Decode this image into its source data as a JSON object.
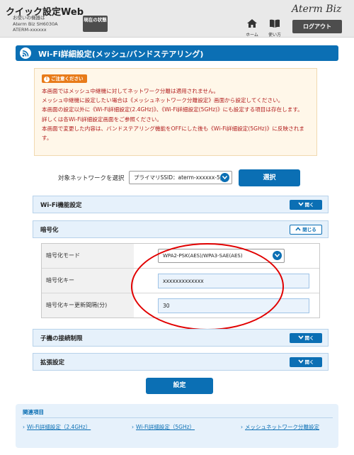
{
  "header": {
    "app_title": "クイック設定Web",
    "model_label": "お使いの機器は",
    "model_name": "Aterm Biz SH6030A",
    "ssid": "ATERM-xxxxxx",
    "status_button": "現在の状態",
    "brand": "Aterm Biz",
    "home_label": "ホーム",
    "guide_label": "使い方",
    "logout_button": "ログアウト"
  },
  "page": {
    "title": "Wi-Fi詳細設定(メッシュ/バンドステアリング)"
  },
  "notice": {
    "badge": "ご注意ください",
    "lines": [
      "本画面ではメッシュ中継機に対してネットワーク分離は適用されません。",
      "メッシュ中継機に設定したい場合は《メッシュネットワーク分離設定》画面から設定してください。",
      "本画面の設定以外に《Wi-Fi詳細設定(2.4GHz)》、《Wi-Fi詳細設定(5GHz)》にも設定する項目は存在します。",
      "詳しくは各Wi-Fi詳細設定画面をご参照ください。",
      "本画面で変更した内容は、バンドステアリング機能をOFFにした後も《Wi-Fi詳細設定(5GHz)》に反映されます。"
    ]
  },
  "network_select": {
    "label": "対象ネットワークを選択",
    "value": "プライマリSSID：aterm-xxxxxx-5p",
    "button": "選択"
  },
  "sections": {
    "wifi_function": {
      "title": "Wi-Fi機能設定",
      "toggle": "開く"
    },
    "encryption": {
      "title": "暗号化",
      "toggle": "閉じる"
    },
    "client_restriction": {
      "title": "子機の接続制限",
      "toggle": "開く"
    },
    "extended": {
      "title": "拡張設定",
      "toggle": "開く"
    }
  },
  "encryption_form": {
    "mode_label": "暗号化モード",
    "mode_value": "WPA2-PSK(AES)/WPA3-SAE(AES)",
    "key_label": "暗号化キー",
    "key_value": "xxxxxxxxxxxxx",
    "interval_label": "暗号化キー更新間隔(分)",
    "interval_value": "30"
  },
  "apply_button": "設定",
  "related": {
    "title": "関連項目",
    "links": [
      "Wi-Fi詳細設定（2.4GHz）",
      "Wi-Fi詳細設定（5GHz）",
      "メッシュネットワーク分離設定"
    ]
  },
  "colors": {
    "accent": "#0b6fb4",
    "notice_text": "#b21e1e",
    "annotation": "#e10000"
  }
}
